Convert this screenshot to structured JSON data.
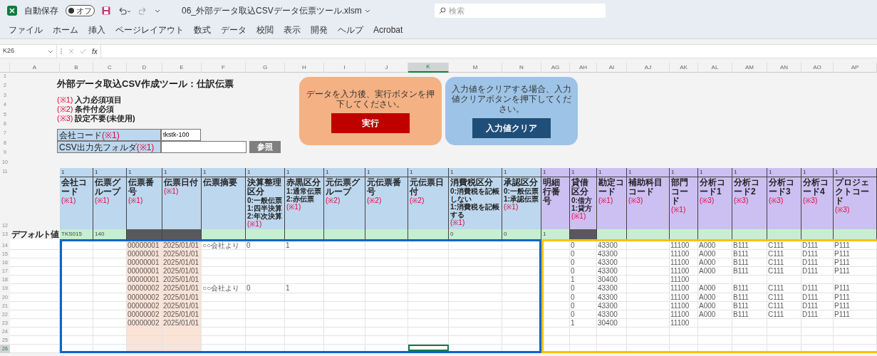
{
  "title_bar": {
    "autosave_label": "自動保存",
    "autosave_toggle": "オフ",
    "autosave_on": false,
    "filename": "06_外部データ取込CSVデータ伝票ツール.xlsm",
    "search_placeholder": "検索"
  },
  "ribbon_tabs": [
    "ファイル",
    "ホーム",
    "挿入",
    "ページレイアウト",
    "数式",
    "データ",
    "校閲",
    "表示",
    "開発",
    "ヘルプ",
    "Acrobat"
  ],
  "formula_bar": {
    "cell_reference": "K26",
    "function_label": "fx"
  },
  "sheet": {
    "top_row_numbers": [
      "1",
      "2",
      "3",
      "4",
      "5",
      "6",
      "7",
      "8",
      "9",
      "10"
    ],
    "title": "外部データ取込CSV作成ツール：仕訳伝票",
    "legend": [
      {
        "mark": "(※1)",
        "label": "入力必須項目"
      },
      {
        "mark": "(※2)",
        "label": "条件付必須"
      },
      {
        "mark": "(※3)",
        "label": "設定不要(未使用)"
      }
    ],
    "fields": [
      {
        "label": "会社コード",
        "mark": "(※1)",
        "value": "tkstk-100"
      },
      {
        "label": "CSV出力先フォルダ",
        "mark": "(※1)",
        "button": "参照"
      }
    ],
    "panels": [
      {
        "kind": "run",
        "message": "データを入力後、実行ボタンを押下してください。",
        "button": "実行"
      },
      {
        "kind": "clear",
        "message": "入力値をクリアする場合、入力値クリアボタンを押下してください。",
        "button": "入力値クリア"
      }
    ],
    "columns": [
      {
        "letter": "A",
        "selected": false
      },
      {
        "letter": "B",
        "selected": false,
        "kind": "input",
        "number": "1",
        "title": "会社コード",
        "note": "(※1)",
        "default": "TKS015"
      },
      {
        "letter": "C",
        "selected": false,
        "kind": "input",
        "number": "1",
        "title": "伝票グループ",
        "note": "(※1)",
        "default": "140"
      },
      {
        "letter": "D",
        "selected": false,
        "kind": "input",
        "number": "1",
        "title": "伝票番号",
        "note": "(※1)",
        "locked": true,
        "shaded": true
      },
      {
        "letter": "E",
        "selected": false,
        "kind": "input",
        "number": "1",
        "title": "伝票日付",
        "note": "(※1)",
        "locked": true,
        "shaded": true
      },
      {
        "letter": "F",
        "selected": false,
        "kind": "input",
        "number": "1",
        "title": "伝票摘要"
      },
      {
        "letter": "G",
        "selected": false,
        "kind": "input",
        "number": "1",
        "title": "決算整理区分",
        "options": [
          "0:一般伝票",
          "1:四半決算",
          "2:年次決算"
        ],
        "note": "(※1)"
      },
      {
        "letter": "H",
        "selected": false,
        "kind": "input",
        "number": "1",
        "title": "赤黒区分",
        "options": [
          "1:通常伝票",
          "2:赤伝票"
        ],
        "note": "(※1)"
      },
      {
        "letter": "I",
        "selected": false,
        "kind": "input",
        "number": "1",
        "title": "元伝票グループ",
        "note": "(※2)"
      },
      {
        "letter": "J",
        "selected": false,
        "kind": "input",
        "number": "1",
        "title": "元伝票番号",
        "note": "(※2)"
      },
      {
        "letter": "K",
        "selected": true,
        "kind": "input",
        "number": "1",
        "title": "元伝票日付",
        "note": "(※2)"
      },
      {
        "letter": "M",
        "selected": false,
        "kind": "input",
        "number": "1",
        "title": "消費税区分",
        "options": [
          "0:消費税を記帳しない",
          "1:消費税を記帳する"
        ],
        "note": "(※1)",
        "default": "0"
      },
      {
        "letter": "N",
        "selected": false,
        "kind": "input",
        "number": "1",
        "title": "承認区分",
        "options": [
          "0:一般伝票",
          "1:承認伝票"
        ],
        "note": "(※1)",
        "default": "0"
      },
      {
        "letter": "AG",
        "selected": false,
        "kind": "detail",
        "number": "1",
        "title": "明細行番号",
        "default": "1"
      },
      {
        "letter": "AH",
        "selected": false,
        "kind": "detail",
        "number": "1",
        "title": "貸借区分",
        "options": [
          "0:借方",
          "1:貸方"
        ],
        "note": "(※1)",
        "locked": true
      },
      {
        "letter": "AI",
        "selected": false,
        "kind": "detail",
        "number": "1",
        "title": "勘定コード",
        "note": "(※1)"
      },
      {
        "letter": "AJ",
        "selected": false,
        "kind": "detail",
        "number": "1",
        "title": "補助科目コード",
        "note": "(※3)"
      },
      {
        "letter": "AK",
        "selected": false,
        "kind": "detail",
        "number": "1",
        "title": "部門コード",
        "note": "(※1)"
      },
      {
        "letter": "AL",
        "selected": false,
        "kind": "detail",
        "number": "1",
        "title": "分析コード1",
        "note": "(※3)"
      },
      {
        "letter": "AM",
        "selected": false,
        "kind": "detail",
        "number": "1",
        "title": "分析コード2",
        "note": "(※3)"
      },
      {
        "letter": "AN",
        "selected": false,
        "kind": "detail",
        "number": "1",
        "title": "分析コード3",
        "note": "(※3)"
      },
      {
        "letter": "AO",
        "selected": false,
        "kind": "detail",
        "number": "1",
        "title": "分析コード4",
        "note": "(※3)"
      },
      {
        "letter": "AP",
        "selected": false,
        "kind": "detail",
        "number": "1",
        "title": "プロジェクトコード",
        "note": "(※3)"
      }
    ],
    "header_row_numbers": [
      "11",
      "12"
    ],
    "default_row": {
      "number": "13",
      "label": "デフォルト値"
    },
    "rows": [
      {
        "number": "14",
        "selected": false,
        "cells": {
          "D": "00000001",
          "E": "2025/01/01",
          "F": "○○会社より",
          "G": "0",
          "H": "1",
          "AH": "0",
          "AI": "43300",
          "AK": "11100",
          "AL": "A000",
          "AM": "B111",
          "AN": "C111",
          "AO": "D111",
          "AP": "P111"
        }
      },
      {
        "number": "15",
        "selected": false,
        "cells": {
          "D": "00000001",
          "E": "2025/01/01",
          "AH": "0",
          "AI": "43300",
          "AK": "11100",
          "AL": "A000",
          "AM": "B111",
          "AN": "C111",
          "AO": "D111",
          "AP": "P111"
        }
      },
      {
        "number": "16",
        "selected": false,
        "cells": {
          "D": "00000001",
          "E": "2025/01/01",
          "AH": "0",
          "AI": "43300",
          "AK": "11100",
          "AL": "A000",
          "AM": "B111",
          "AN": "C111",
          "AO": "D111",
          "AP": "P111"
        }
      },
      {
        "number": "17",
        "selected": false,
        "cells": {
          "D": "00000001",
          "E": "2025/01/01",
          "AH": "0",
          "AI": "43300",
          "AK": "11100",
          "AL": "A000",
          "AM": "B111",
          "AN": "C111",
          "AO": "D111",
          "AP": "P111"
        }
      },
      {
        "number": "18",
        "selected": false,
        "cells": {
          "D": "00000001",
          "E": "2025/01/01",
          "AH": "1",
          "AI": "30400",
          "AK": "11100"
        }
      },
      {
        "number": "19",
        "selected": false,
        "cells": {
          "D": "00000002",
          "E": "2025/01/01",
          "F": "○○会社より",
          "G": "0",
          "H": "1",
          "AH": "0",
          "AI": "43300",
          "AK": "11100",
          "AL": "A000",
          "AM": "B111",
          "AN": "C111",
          "AO": "D111",
          "AP": "P111"
        }
      },
      {
        "number": "20",
        "selected": false,
        "cells": {
          "D": "00000002",
          "E": "2025/01/01",
          "AH": "0",
          "AI": "43300",
          "AK": "11100",
          "AL": "A000",
          "AM": "B111",
          "AN": "C111",
          "AO": "D111",
          "AP": "P111"
        }
      },
      {
        "number": "21",
        "selected": false,
        "cells": {
          "D": "00000002",
          "E": "2025/01/01",
          "AH": "0",
          "AI": "43300",
          "AK": "11100",
          "AL": "A000",
          "AM": "B111",
          "AN": "C111",
          "AO": "D111",
          "AP": "P111"
        }
      },
      {
        "number": "22",
        "selected": false,
        "cells": {
          "D": "00000002",
          "E": "2025/01/01",
          "AH": "0",
          "AI": "43300",
          "AK": "11100",
          "AL": "A000",
          "AM": "B111",
          "AN": "C111",
          "AO": "D111",
          "AP": "P111"
        }
      },
      {
        "number": "23",
        "selected": false,
        "cells": {
          "D": "00000002",
          "E": "2025/01/01",
          "AH": "1",
          "AI": "30400",
          "AK": "11100"
        }
      },
      {
        "number": "24",
        "selected": false,
        "cells": {}
      },
      {
        "number": "25",
        "selected": false,
        "cells": {}
      },
      {
        "number": "26",
        "selected": true,
        "cells": {}
      }
    ],
    "highlights": [
      {
        "kind": "input",
        "color": "#0066cc"
      },
      {
        "kind": "detail",
        "color": "#ffc000"
      }
    ]
  }
}
